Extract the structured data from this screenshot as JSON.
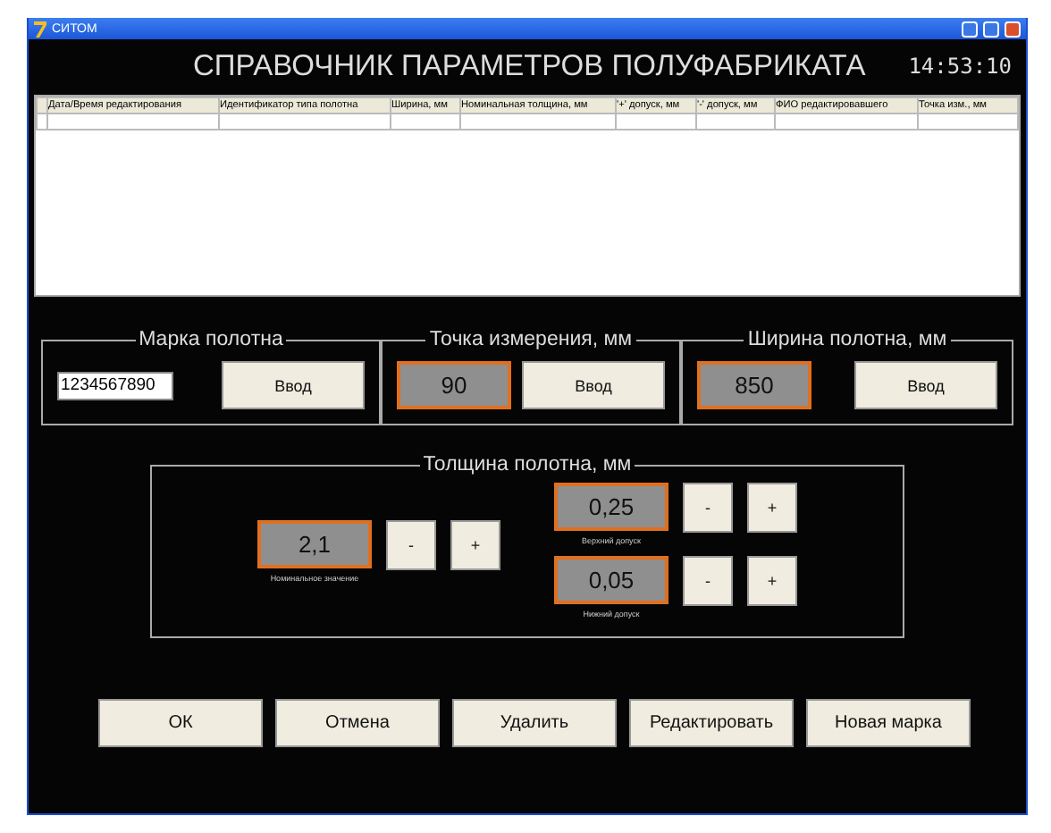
{
  "window": {
    "title": "СИТОМ",
    "heading": "СПРАВОЧНИК ПАРАМЕТРОВ ПОЛУФАБРИКАТА",
    "clock": "14:53:10"
  },
  "table": {
    "columns": [
      "Дата/Время редактирования",
      "Идентификатор типа полотна",
      "Ширина, мм",
      "Номинальная толщина, мм",
      "'+' допуск, мм",
      "'-' допуск, мм",
      "ФИО редактировавшего",
      "Точка изм., мм"
    ]
  },
  "groups": [
    {
      "title": "Марка полотна",
      "kind": "input",
      "value": "1234567890",
      "button": "Ввод"
    },
    {
      "title": "Точка измерения, мм",
      "kind": "display",
      "value": "90",
      "button": "Ввод"
    },
    {
      "title": "Ширина полотна, мм",
      "kind": "display",
      "value": "850",
      "button": "Ввод"
    }
  ],
  "thickness": {
    "title": "Толщина полотна, мм",
    "nominal": {
      "value": "2,1",
      "caption": "Номинальное значение",
      "minus": "-",
      "plus": "+"
    },
    "upper": {
      "value": "0,25",
      "caption": "Верхний допуск",
      "minus": "-",
      "plus": "+"
    },
    "lower": {
      "value": "0,05",
      "caption": "Нижний допуск",
      "minus": "-",
      "plus": "+"
    }
  },
  "buttons": [
    "ОК",
    "Отмена",
    "Удалить",
    "Редактировать",
    "Новая марка"
  ]
}
